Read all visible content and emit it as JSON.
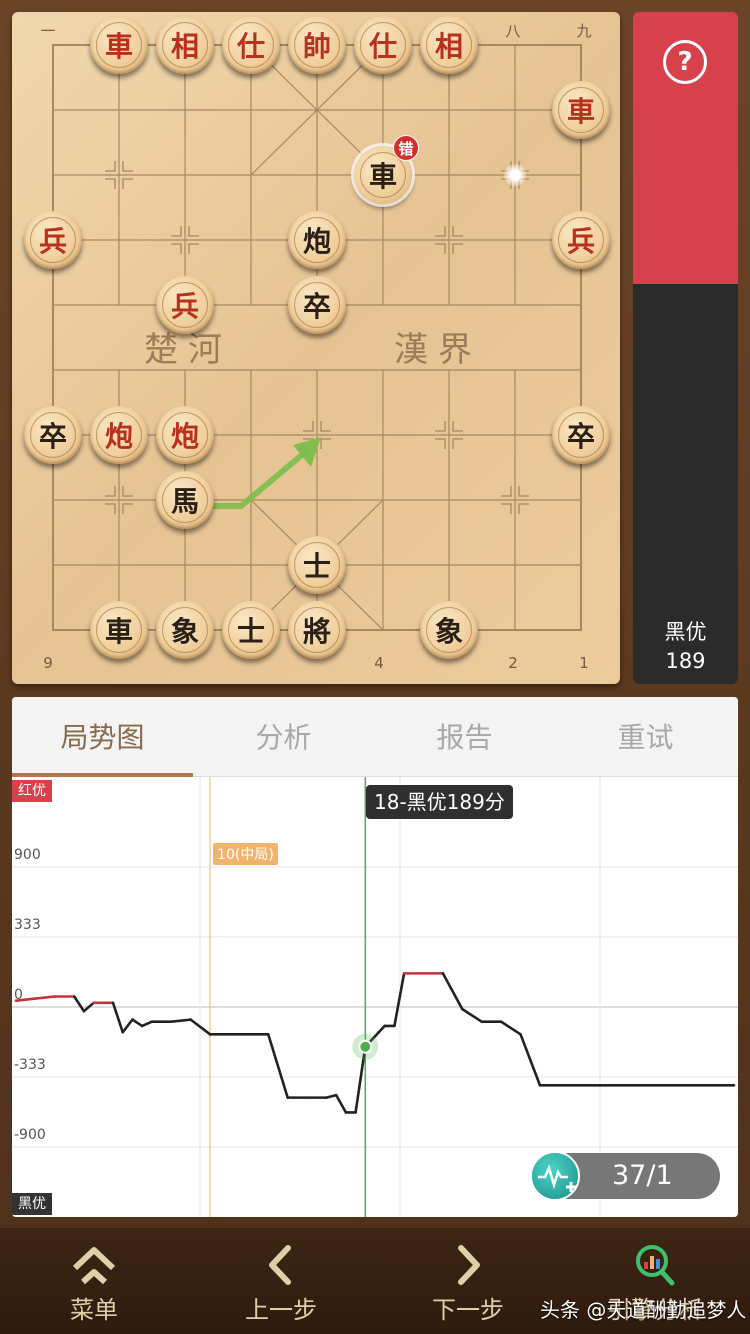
{
  "board": {
    "file_labels_top": [
      "一",
      "八",
      "九"
    ],
    "file_labels_bottom": [
      "9",
      "4",
      "2",
      "1"
    ],
    "river_left": "楚河",
    "river_right": "漢界",
    "wrong_badge": "错",
    "pieces": [
      {
        "char": "車",
        "side": "red",
        "col": 1,
        "row": 0
      },
      {
        "char": "相",
        "side": "red",
        "col": 2,
        "row": 0
      },
      {
        "char": "仕",
        "side": "red",
        "col": 3,
        "row": 0
      },
      {
        "char": "帥",
        "side": "red",
        "col": 4,
        "row": 0
      },
      {
        "char": "仕",
        "side": "red",
        "col": 5,
        "row": 0
      },
      {
        "char": "相",
        "side": "red",
        "col": 6,
        "row": 0
      },
      {
        "char": "車",
        "side": "red",
        "col": 8,
        "row": 1
      },
      {
        "char": "車",
        "side": "black",
        "col": 5,
        "row": 2,
        "selected": true
      },
      {
        "char": "兵",
        "side": "red",
        "col": 0,
        "row": 3
      },
      {
        "char": "炮",
        "side": "black",
        "col": 4,
        "row": 3
      },
      {
        "char": "兵",
        "side": "red",
        "col": 8,
        "row": 3
      },
      {
        "char": "兵",
        "side": "red",
        "col": 2,
        "row": 4
      },
      {
        "char": "卒",
        "side": "black",
        "col": 4,
        "row": 4
      },
      {
        "char": "卒",
        "side": "black",
        "col": 0,
        "row": 6
      },
      {
        "char": "炮",
        "side": "red",
        "col": 1,
        "row": 6
      },
      {
        "char": "炮",
        "side": "red",
        "col": 2,
        "row": 6
      },
      {
        "char": "卒",
        "side": "black",
        "col": 8,
        "row": 6
      },
      {
        "char": "馬",
        "side": "black",
        "col": 2,
        "row": 7
      },
      {
        "char": "士",
        "side": "black",
        "col": 4,
        "row": 8
      },
      {
        "char": "車",
        "side": "black",
        "col": 1,
        "row": 9
      },
      {
        "char": "象",
        "side": "black",
        "col": 2,
        "row": 9
      },
      {
        "char": "士",
        "side": "black",
        "col": 3,
        "row": 9
      },
      {
        "char": "將",
        "side": "black",
        "col": 4,
        "row": 9
      },
      {
        "char": "象",
        "side": "black",
        "col": 6,
        "row": 9
      }
    ],
    "move_target": {
      "col": 7,
      "row": 2
    },
    "hint_arrow": {
      "from": {
        "col": 2,
        "row": 7
      },
      "to": {
        "col": 4,
        "row": 6
      }
    },
    "colors": {
      "red_piece": "#b8311e",
      "black_piece": "#2b2016",
      "arrow": "#7cbf4a"
    }
  },
  "eval_bar": {
    "help_icon": "question-icon",
    "label": "黑优",
    "value": "189",
    "red_fraction": 0.405,
    "colors": {
      "red": "#d6414b",
      "black": "#2b2b2b"
    }
  },
  "tabs": [
    {
      "label": "局势图",
      "active": true
    },
    {
      "label": "分析",
      "active": false
    },
    {
      "label": "报告",
      "active": false
    },
    {
      "label": "重试",
      "active": false
    }
  ],
  "chart_data": {
    "type": "line",
    "y_ticks": [
      "900",
      "333",
      "0",
      "-333",
      "-900"
    ],
    "red_adv_label": "红优",
    "black_adv_label": "黑优",
    "phase_marker": {
      "move": 10,
      "label": "10(中局)"
    },
    "cursor": {
      "move": 18,
      "label": "18-黑优189分"
    },
    "moves_total": 37,
    "series": [
      {
        "x": [
          0,
          1,
          2,
          3,
          3.5,
          4,
          5,
          5.5,
          6,
          6.5,
          7,
          8,
          9,
          10,
          11,
          12,
          13,
          14,
          15,
          16,
          16.5,
          17,
          17.5,
          18,
          19,
          19.5,
          20,
          20.5,
          21,
          22,
          23,
          24,
          25,
          26,
          27,
          28,
          29,
          30,
          31,
          32,
          33,
          34,
          35,
          36,
          37
        ],
        "y": [
          30,
          40,
          50,
          50,
          -20,
          20,
          20,
          -120,
          -60,
          -90,
          -70,
          -70,
          -60,
          -130,
          -130,
          -130,
          -130,
          -500,
          -500,
          -500,
          -480,
          -620,
          -620,
          -189,
          -90,
          -90,
          160,
          160,
          160,
          160,
          -10,
          -70,
          -70,
          -130,
          -400,
          -400,
          -400,
          -400,
          -400,
          -400,
          -400,
          -400,
          -400,
          -400,
          -400
        ]
      }
    ],
    "colors": {
      "red_line": "#c8323c",
      "black_line": "#222222",
      "cursor": "#4cb04c",
      "phase": "#f1b46d"
    }
  },
  "move_counter": {
    "icon": "waveform-add-icon",
    "text": "37/1"
  },
  "bottom_nav": [
    {
      "label": "菜单",
      "icon": "menu-chevron-icon"
    },
    {
      "label": "上一步",
      "icon": "chevron-left-icon"
    },
    {
      "label": "下一步",
      "icon": "chevron-right-icon"
    },
    {
      "label": "引擎分析",
      "icon": "search-chart-icon"
    }
  ],
  "watermark": "头条 @天道酬勤追梦人"
}
